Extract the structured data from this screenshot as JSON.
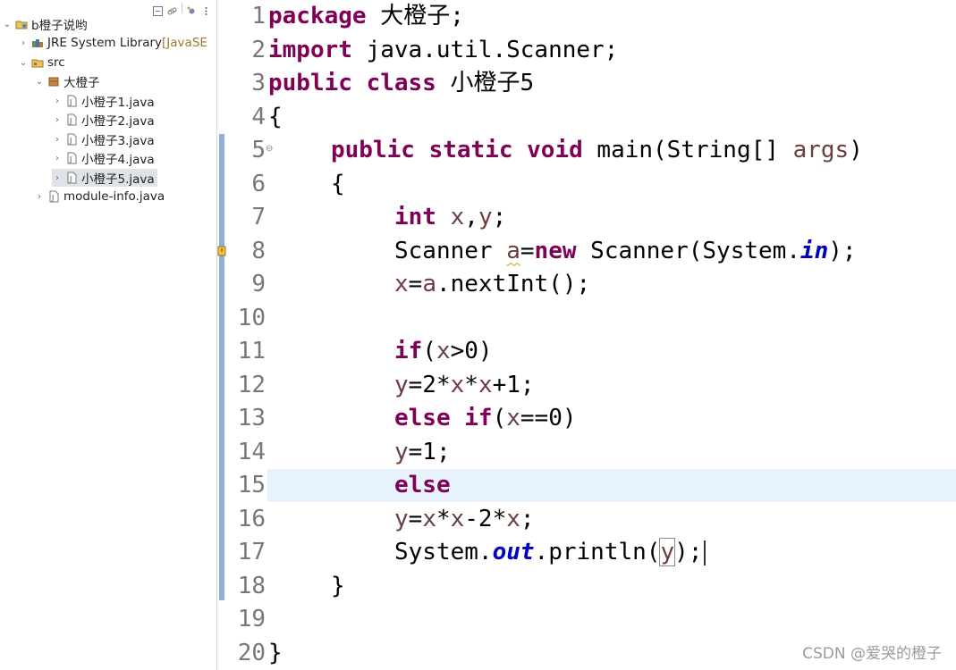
{
  "explorer": {
    "project": "b橙子说哟",
    "jre_label": "JRE System Library",
    "jre_suffix": " [JavaSE",
    "src": "src",
    "package": "大橙子",
    "files": [
      "小橙子1.java",
      "小橙子2.java",
      "小橙子3.java",
      "小橙子4.java",
      "小橙子5.java"
    ],
    "module_info": "module-info.java",
    "selected_file": "小橙子5.java"
  },
  "editor": {
    "line_numbers": [
      "1",
      "2",
      "3",
      "4",
      "5",
      "6",
      "7",
      "8",
      "9",
      "10",
      "11",
      "12",
      "13",
      "14",
      "15",
      "16",
      "17",
      "18",
      "19",
      "20"
    ],
    "current_line": "15",
    "code": {
      "l1_kw": "package",
      "l1_rest": " 大橙子;",
      "l2_kw": "import",
      "l2_rest": " java.util.Scanner;",
      "l3_kw": "public class",
      "l3_rest": " 小橙子5",
      "l4": "{",
      "l5_kw": "public static void",
      "l5_a": " main(String[] ",
      "l5_var": "args",
      "l5_b": ")",
      "l6": "{",
      "l7_kw": "int",
      "l7_a": " ",
      "l7_x": "x",
      "l7_comma": ",",
      "l7_y": "y",
      "l7_semi": ";",
      "l8_a": "Scanner ",
      "l8_var": "a",
      "l8_eq": "=",
      "l8_kw": "new",
      "l8_b": " Scanner(System.",
      "l8_field": "in",
      "l8_c": ");",
      "l9_x": "x",
      "l9_a": "=",
      "l9_var": "a",
      "l9_b": ".nextInt();",
      "l11_kw": "if",
      "l11_a": "(",
      "l11_x": "x",
      "l11_b": ">0)",
      "l12_y": "y",
      "l12_a": "=2*",
      "l12_x1": "x",
      "l12_b": "*",
      "l12_x2": "x",
      "l12_c": "+1;",
      "l13_kw": "else if",
      "l13_a": "(",
      "l13_x": "x",
      "l13_b": "==0)",
      "l14_y": "y",
      "l14_a": "=1;",
      "l15_kw": "else",
      "l16_y": "y",
      "l16_a": "=",
      "l16_x1": "x",
      "l16_b": "*",
      "l16_x2": "x",
      "l16_c": "-2*",
      "l16_x3": "x",
      "l16_d": ";",
      "l17_a": "System.",
      "l17_field": "out",
      "l17_b": ".println(",
      "l17_y": "y",
      "l17_c": ");",
      "l18": "}",
      "l20": "}"
    }
  },
  "watermark": "CSDN @爱哭的橙子",
  "colors": {
    "keyword": "#7f0055",
    "local_variable": "#6a3e3e",
    "static_field": "#0000c0",
    "current_line_highlight": "#e8f2fe",
    "selection": "#dfe3e8"
  }
}
